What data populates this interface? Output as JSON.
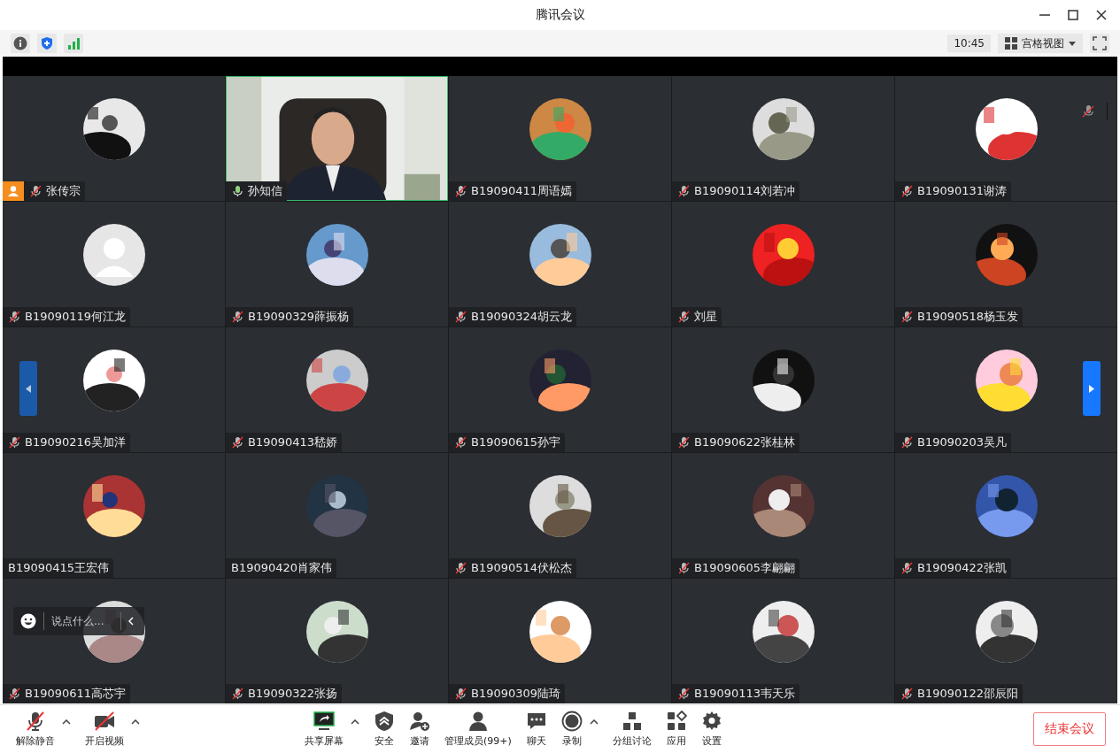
{
  "window": {
    "title": "腾讯会议"
  },
  "toolbar": {
    "time": "10:45",
    "view_mode": "宫格视图"
  },
  "participants": [
    {
      "name": "张传宗",
      "mic": true,
      "muted": true,
      "host": true,
      "kind": "picture"
    },
    {
      "name": "孙知信",
      "mic": true,
      "muted": false,
      "host": false,
      "kind": "video"
    },
    {
      "name": "B19090411周语嫣",
      "mic": true,
      "muted": true,
      "host": false,
      "kind": "picture"
    },
    {
      "name": "B19090114刘若冲",
      "mic": true,
      "muted": true,
      "host": false,
      "kind": "picture"
    },
    {
      "name": "B19090131谢涛",
      "mic": true,
      "muted": true,
      "host": false,
      "kind": "picture"
    },
    {
      "name": "B19090119何江龙",
      "mic": true,
      "muted": true,
      "host": false,
      "kind": "default"
    },
    {
      "name": "B19090329薛振杨",
      "mic": true,
      "muted": true,
      "host": false,
      "kind": "picture"
    },
    {
      "name": "B19090324胡云龙",
      "mic": true,
      "muted": true,
      "host": false,
      "kind": "picture"
    },
    {
      "name": "刘星",
      "mic": true,
      "muted": true,
      "host": false,
      "kind": "picture"
    },
    {
      "name": "B19090518杨玉发",
      "mic": true,
      "muted": true,
      "host": false,
      "kind": "picture"
    },
    {
      "name": "B19090216吴加洋",
      "mic": true,
      "muted": true,
      "host": false,
      "kind": "picture"
    },
    {
      "name": "B19090413嵇娇",
      "mic": true,
      "muted": true,
      "host": false,
      "kind": "picture"
    },
    {
      "name": "B19090615孙宇",
      "mic": true,
      "muted": true,
      "host": false,
      "kind": "picture"
    },
    {
      "name": "B19090622张桂林",
      "mic": true,
      "muted": true,
      "host": false,
      "kind": "picture"
    },
    {
      "name": "B19090203吴凡",
      "mic": true,
      "muted": true,
      "host": false,
      "kind": "picture"
    },
    {
      "name": "B19090415王宏伟",
      "mic": false,
      "host": false,
      "kind": "picture"
    },
    {
      "name": "B19090420肖家伟",
      "mic": false,
      "host": false,
      "kind": "picture"
    },
    {
      "name": "B19090514伏松杰",
      "mic": true,
      "muted": true,
      "host": false,
      "kind": "picture"
    },
    {
      "name": "B19090605李翩翩",
      "mic": true,
      "muted": true,
      "host": false,
      "kind": "picture"
    },
    {
      "name": "B19090422张凯",
      "mic": true,
      "muted": true,
      "host": false,
      "kind": "picture"
    },
    {
      "name": "B19090611高芯宇",
      "mic": true,
      "muted": true,
      "host": false,
      "kind": "picture"
    },
    {
      "name": "B19090322张扬",
      "mic": true,
      "muted": true,
      "host": false,
      "kind": "picture"
    },
    {
      "name": "B19090309陆琦",
      "mic": true,
      "muted": true,
      "host": false,
      "kind": "picture"
    },
    {
      "name": "B19090113韦天乐",
      "mic": true,
      "muted": true,
      "host": false,
      "kind": "picture"
    },
    {
      "name": "B19090122邵辰阳",
      "mic": true,
      "muted": true,
      "host": false,
      "kind": "picture"
    }
  ],
  "chat_box": {
    "placeholder": "说点什么..."
  },
  "bottom_bar": [
    {
      "kind": "mic",
      "label": "解除静音",
      "caret": true
    },
    {
      "kind": "camera",
      "label": "开启视频",
      "caret": true
    },
    {
      "kind": "share",
      "label": "共享屏幕",
      "caret": true
    },
    {
      "kind": "security",
      "label": "安全",
      "caret": false
    },
    {
      "kind": "invite",
      "label": "邀请",
      "caret": false
    },
    {
      "kind": "members",
      "label": "管理成员(99+)",
      "caret": false
    },
    {
      "kind": "chat",
      "label": "聊天",
      "caret": false
    },
    {
      "kind": "record",
      "label": "录制",
      "caret": true
    },
    {
      "kind": "breakout",
      "label": "分组讨论",
      "caret": false
    },
    {
      "kind": "apps",
      "label": "应用",
      "caret": false
    },
    {
      "kind": "settings",
      "label": "设置",
      "caret": false
    }
  ],
  "end_button": {
    "label": "结束会议"
  }
}
